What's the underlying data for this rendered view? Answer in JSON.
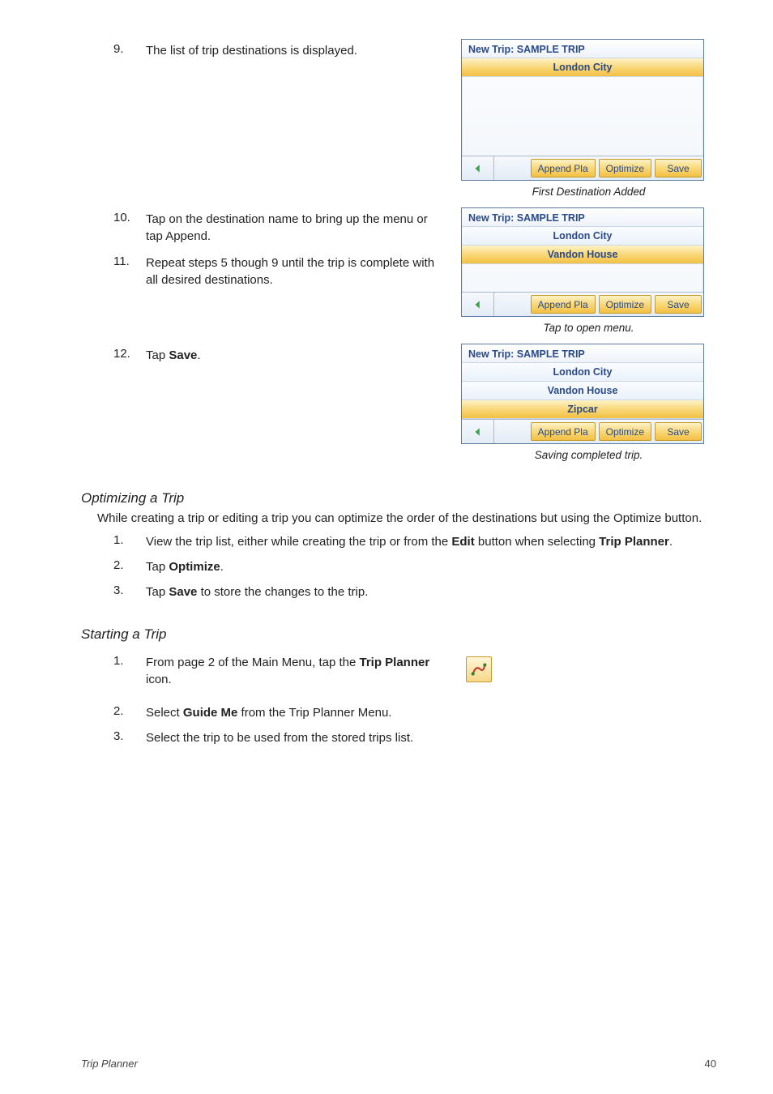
{
  "steps_a": {
    "9": {
      "num": "9.",
      "text": "The list of trip destinations is displayed."
    },
    "10": {
      "num": "10.",
      "text": "Tap on the destination name to bring up the menu or tap Append."
    },
    "11": {
      "num": "11.",
      "text": "Repeat steps 5 though 9 until the trip is complete with all desired destinations."
    },
    "12": {
      "num": "12.",
      "text_prefix": "Tap ",
      "bold": "Save",
      "text_suffix": "."
    }
  },
  "mock1": {
    "title": "New Trip: SAMPLE TRIP",
    "rows": [
      "London City"
    ],
    "btns": {
      "append": "Append Pla",
      "optimize": "Optimize",
      "save": "Save"
    },
    "caption": "First Destination Added"
  },
  "mock2": {
    "title": "New Trip: SAMPLE TRIP",
    "rows": [
      "London City",
      "Vandon House"
    ],
    "btns": {
      "append": "Append Pla",
      "optimize": "Optimize",
      "save": "Save"
    },
    "caption": "Tap to open menu."
  },
  "mock3": {
    "title": "New Trip: SAMPLE TRIP",
    "rows": [
      "London City",
      "Vandon House",
      "Zipcar"
    ],
    "btns": {
      "append": "Append Pla",
      "optimize": "Optimize",
      "save": "Save"
    },
    "caption": "Saving completed trip."
  },
  "opt": {
    "heading": "Optimizing a Trip",
    "intro": "While creating a trip or editing a trip you can optimize the order of the destinations but using the Optimize button.",
    "s1": {
      "num": "1.",
      "p1": "View the trip list, either while creating the trip or from the ",
      "b1": "Edit",
      "p2": " button when selecting ",
      "b2": "Trip Planner",
      "p3": "."
    },
    "s2": {
      "num": "2.",
      "p1": "Tap ",
      "b1": "Optimize",
      "p2": "."
    },
    "s3": {
      "num": "3.",
      "p1": "Tap ",
      "b1": "Save",
      "p2": " to store the changes to the trip."
    }
  },
  "start": {
    "heading": "Starting a Trip",
    "s1": {
      "num": "1.",
      "p1": "From page 2 of the Main Menu, tap the ",
      "b1": "Trip Planner",
      "p2": " icon."
    },
    "s2": {
      "num": "2.",
      "p1": "Select ",
      "b1": "Guide Me",
      "p2": " from the Trip Planner Menu."
    },
    "s3": {
      "num": "3.",
      "text": "Select the trip to be used from the stored trips list."
    }
  },
  "footer": {
    "section": "Trip Planner",
    "page": "40"
  }
}
